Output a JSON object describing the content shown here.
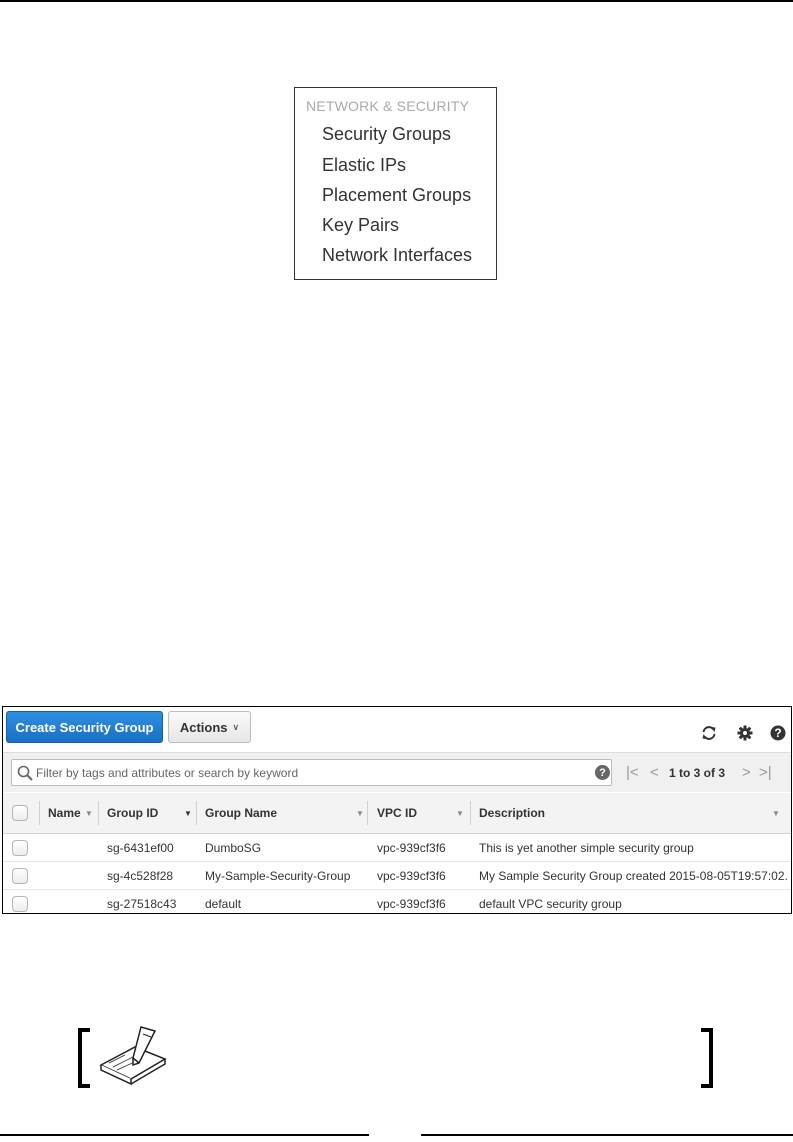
{
  "nav": {
    "heading": "NETWORK & SECURITY",
    "items": [
      {
        "label": "Security Groups"
      },
      {
        "label": "Elastic IPs"
      },
      {
        "label": "Placement Groups"
      },
      {
        "label": "Key Pairs"
      },
      {
        "label": "Network Interfaces"
      }
    ]
  },
  "toolbar": {
    "create_label": "Create Security Group",
    "actions_label": "Actions",
    "actions_chevron": "∨",
    "icons": [
      "refresh-icon",
      "gear-icon",
      "help-icon"
    ]
  },
  "filter": {
    "placeholder": "Filter by tags and attributes or search by keyword",
    "help_glyph": "?",
    "pager_text": "1 to 3 of 3"
  },
  "table": {
    "columns": [
      {
        "label": "Name"
      },
      {
        "label": "Group ID"
      },
      {
        "label": "Group Name"
      },
      {
        "label": "VPC ID"
      },
      {
        "label": "Description"
      }
    ],
    "rows": [
      {
        "name": "",
        "group_id": "sg-6431ef00",
        "group_name": "DumboSG",
        "vpc_id": "vpc-939cf3f6",
        "description": "This is yet another simple security group"
      },
      {
        "name": "",
        "group_id": "sg-4c528f28",
        "group_name": "My-Sample-Security-Group",
        "vpc_id": "vpc-939cf3f6",
        "description": "My Sample Security Group created 2015-08-05T19:57:02...."
      },
      {
        "name": "",
        "group_id": "sg-27518c43",
        "group_name": "default",
        "vpc_id": "vpc-939cf3f6",
        "description": "default VPC security group"
      }
    ]
  },
  "colors": {
    "accent": "#1a6fc4",
    "heading_gray": "#a9a9a9"
  }
}
